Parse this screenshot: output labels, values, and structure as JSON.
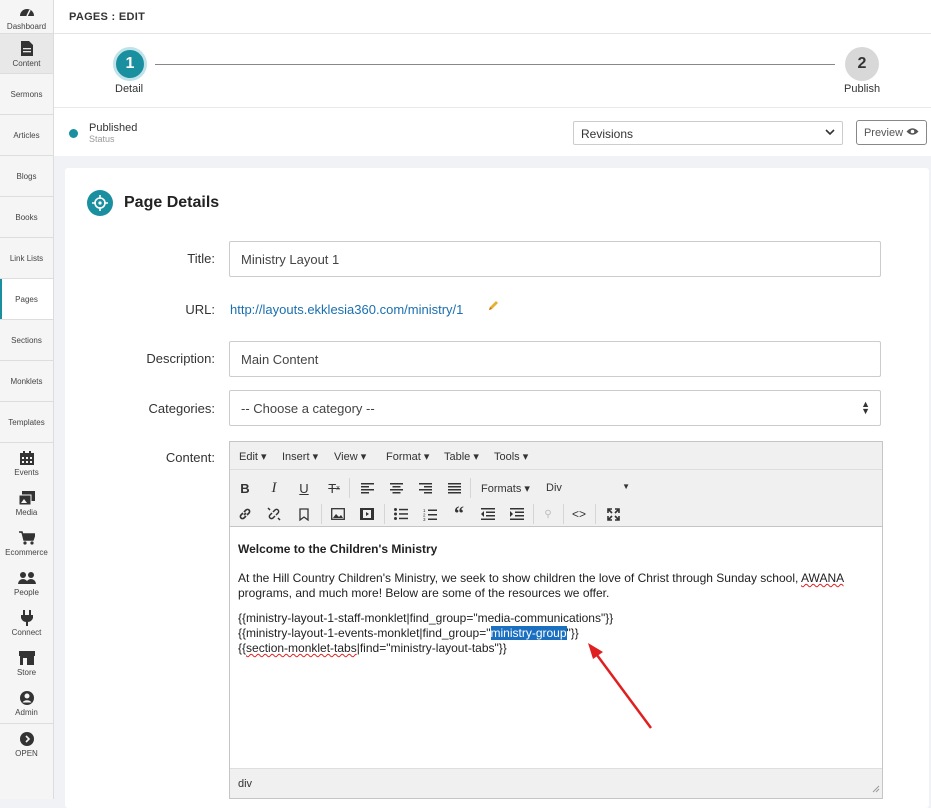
{
  "sidebar": {
    "items": [
      {
        "label": "Dashboard",
        "icon": "dashboard-icon"
      },
      {
        "label": "Content",
        "icon": "document-icon"
      },
      {
        "label": "Sermons"
      },
      {
        "label": "Articles"
      },
      {
        "label": "Blogs"
      },
      {
        "label": "Books"
      },
      {
        "label": "Link Lists"
      },
      {
        "label": "Pages"
      },
      {
        "label": "Sections"
      },
      {
        "label": "Monklets"
      },
      {
        "label": "Templates"
      },
      {
        "label": "Events",
        "icon": "calendar-icon"
      },
      {
        "label": "Media",
        "icon": "media-icon"
      },
      {
        "label": "Ecommerce",
        "icon": "cart-icon"
      },
      {
        "label": "People",
        "icon": "people-icon"
      },
      {
        "label": "Connect",
        "icon": "plug-icon"
      },
      {
        "label": "Store",
        "icon": "store-icon"
      },
      {
        "label": "Admin",
        "icon": "user-icon"
      },
      {
        "label": "OPEN",
        "icon": "chevron-right-icon"
      }
    ]
  },
  "header": {
    "breadcrumb": "PAGES : EDIT"
  },
  "steps": [
    {
      "number": "1",
      "label": "Detail"
    },
    {
      "number": "2",
      "label": "Publish"
    }
  ],
  "status": {
    "value": "Published",
    "caption": "Status"
  },
  "revisions": {
    "label": "Revisions"
  },
  "preview": {
    "label": "Preview"
  },
  "card": {
    "title": "Page Details"
  },
  "form": {
    "title_label": "Title:",
    "title_value": "Ministry Layout 1",
    "url_label": "URL:",
    "url_value": "http://layouts.ekklesia360.com/ministry/1",
    "description_label": "Description:",
    "description_value": "Main Content",
    "categories_label": "Categories:",
    "categories_value": "-- Choose a category --",
    "content_label": "Content:"
  },
  "editor": {
    "menus": [
      "Edit",
      "Insert",
      "View",
      "Format",
      "Table",
      "Tools"
    ],
    "formats_label": "Formats",
    "block_label": "Div",
    "heading": "Welcome to the Children's Ministry",
    "intro_before": "At the Hill Country Children's Ministry, we seek to show children the love of Christ through Sunday school, ",
    "intro_awana": "AWANA",
    "intro_after": " programs, and much more! Below are some of the resources we offer.",
    "line1": "{{ministry-layout-1-staff-monklet|find_group=\"media-communications\"}}",
    "line2_before": "{{ministry-layout-1-events-monklet|find_group=\"",
    "line2_selected": "ministry-group",
    "line2_after": "\"}}",
    "line3_before": "{{",
    "line3_squig": "section-monklet-tabs",
    "line3_after": "|find=\"ministry-layout-tabs\"}}",
    "statusbar_path": "div"
  },
  "colors": {
    "accent": "#1a8fa0",
    "link": "#1a6fb0",
    "selection": "#1a6fc0",
    "arrow": "#e02020"
  }
}
